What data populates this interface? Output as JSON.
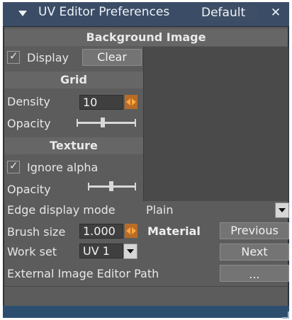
{
  "title": "UV Editor Preferences",
  "preset": "Default",
  "close": "✕",
  "sections": {
    "background": "Background Image",
    "grid": "Grid",
    "texture": "Texture",
    "material": "Material"
  },
  "controls": {
    "display": {
      "label": "Display",
      "checked": true
    },
    "clear": "Clear",
    "density_label": "Density",
    "density_value": "10",
    "grid_opacity_label": "Opacity",
    "ignore_alpha": {
      "label": "Ignore alpha",
      "checked": true
    },
    "texture_opacity_label": "Opacity",
    "edge_display_mode_label": "Edge display mode",
    "edge_display_mode_value": "Plain",
    "brush_size_label": "Brush size",
    "brush_size_value": "1.000",
    "work_set_label": "Work set",
    "work_set_value": "UV 1",
    "previous": "Previous",
    "next": "Next",
    "external_image_editor_path_label": "External Image Editor Path",
    "browse": "..."
  }
}
